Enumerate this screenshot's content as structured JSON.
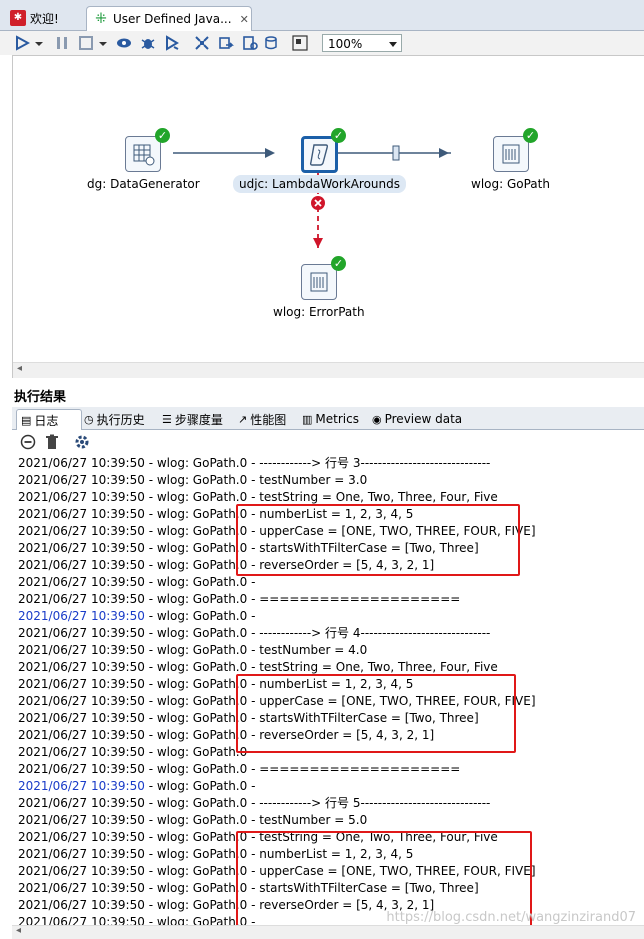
{
  "tabs": [
    {
      "label": "欢迎!",
      "active": false
    },
    {
      "label": "User Defined Java...",
      "active": true
    }
  ],
  "toolbar": {
    "zoom": "100%"
  },
  "canvas": {
    "steps": [
      {
        "label": "dg: DataGenerator"
      },
      {
        "label": "udjc: LambdaWorkArounds"
      },
      {
        "label": "wlog: GoPath"
      },
      {
        "label": "wlog: ErrorPath"
      }
    ]
  },
  "results": {
    "title": "执行结果",
    "tabs": [
      {
        "label": "日志",
        "icon": "log-icon"
      },
      {
        "label": "执行历史",
        "icon": "history-icon"
      },
      {
        "label": "步骤度量",
        "icon": "step-metrics-icon"
      },
      {
        "label": "性能图",
        "icon": "chart-icon"
      },
      {
        "label": "Metrics",
        "icon": "metrics-icon"
      },
      {
        "label": "Preview data",
        "icon": "eye-icon"
      }
    ]
  },
  "log": [
    {
      "ts": "2021/06/27 10:39:50",
      "msg": " - wlog: GoPath.0 - ------------> 行号 3------------------------------",
      "blue": false
    },
    {
      "ts": "2021/06/27 10:39:50",
      "msg": " - wlog: GoPath.0 - testNumber = 3.0",
      "blue": false
    },
    {
      "ts": "2021/06/27 10:39:50",
      "msg": " - wlog: GoPath.0 - testString = One, Two, Three, Four, Five",
      "blue": false
    },
    {
      "ts": "2021/06/27 10:39:50",
      "msg": " - wlog: GoPath.0 - numberList = 1, 2, 3, 4, 5",
      "blue": false
    },
    {
      "ts": "2021/06/27 10:39:50",
      "msg": " - wlog: GoPath.0 - upperCase = [ONE, TWO, THREE, FOUR, FIVE]",
      "blue": false
    },
    {
      "ts": "2021/06/27 10:39:50",
      "msg": " - wlog: GoPath.0 - startsWithTFilterCase = [Two, Three]",
      "blue": false
    },
    {
      "ts": "2021/06/27 10:39:50",
      "msg": " - wlog: GoPath.0 - reverseOrder = [5, 4, 3, 2, 1]",
      "blue": false
    },
    {
      "ts": "2021/06/27 10:39:50",
      "msg": " - wlog: GoPath.0 - ",
      "blue": false
    },
    {
      "ts": "2021/06/27 10:39:50",
      "msg": " - wlog: GoPath.0 - ====================",
      "blue": false
    },
    {
      "ts": "2021/06/27 10:39:50",
      "msg": " - wlog: GoPath.0 - ",
      "blue": true
    },
    {
      "ts": "2021/06/27 10:39:50",
      "msg": " - wlog: GoPath.0 - ------------> 行号 4------------------------------",
      "blue": false
    },
    {
      "ts": "2021/06/27 10:39:50",
      "msg": " - wlog: GoPath.0 - testNumber = 4.0",
      "blue": false
    },
    {
      "ts": "2021/06/27 10:39:50",
      "msg": " - wlog: GoPath.0 - testString = One, Two, Three, Four, Five",
      "blue": false
    },
    {
      "ts": "2021/06/27 10:39:50",
      "msg": " - wlog: GoPath.0 - numberList = 1, 2, 3, 4, 5",
      "blue": false
    },
    {
      "ts": "2021/06/27 10:39:50",
      "msg": " - wlog: GoPath.0 - upperCase = [ONE, TWO, THREE, FOUR, FIVE]",
      "blue": false
    },
    {
      "ts": "2021/06/27 10:39:50",
      "msg": " - wlog: GoPath.0 - startsWithTFilterCase = [Two, Three]",
      "blue": false
    },
    {
      "ts": "2021/06/27 10:39:50",
      "msg": " - wlog: GoPath.0 - reverseOrder = [5, 4, 3, 2, 1]",
      "blue": false
    },
    {
      "ts": "2021/06/27 10:39:50",
      "msg": " - wlog: GoPath.0 - ",
      "blue": false
    },
    {
      "ts": "2021/06/27 10:39:50",
      "msg": " - wlog: GoPath.0 - ====================",
      "blue": false
    },
    {
      "ts": "2021/06/27 10:39:50",
      "msg": " - wlog: GoPath.0 - ",
      "blue": true
    },
    {
      "ts": "2021/06/27 10:39:50",
      "msg": " - wlog: GoPath.0 - ------------> 行号 5------------------------------",
      "blue": false
    },
    {
      "ts": "2021/06/27 10:39:50",
      "msg": " - wlog: GoPath.0 - testNumber = 5.0",
      "blue": false
    },
    {
      "ts": "2021/06/27 10:39:50",
      "msg": " - wlog: GoPath.0 - testString = One, Two, Three, Four, Five",
      "blue": false
    },
    {
      "ts": "2021/06/27 10:39:50",
      "msg": " - wlog: GoPath.0 - numberList = 1, 2, 3, 4, 5",
      "blue": false
    },
    {
      "ts": "2021/06/27 10:39:50",
      "msg": " - wlog: GoPath.0 - upperCase = [ONE, TWO, THREE, FOUR, FIVE]",
      "blue": false
    },
    {
      "ts": "2021/06/27 10:39:50",
      "msg": " - wlog: GoPath.0 - startsWithTFilterCase = [Two, Three]",
      "blue": false
    },
    {
      "ts": "2021/06/27 10:39:50",
      "msg": " - wlog: GoPath.0 - reverseOrder = [5, 4, 3, 2, 1]",
      "blue": false
    },
    {
      "ts": "2021/06/27 10:39:50",
      "msg": " - wlog: GoPath.0 - ",
      "blue": false
    }
  ],
  "watermark": "https://blog.csdn.net/wangzinzirand07"
}
